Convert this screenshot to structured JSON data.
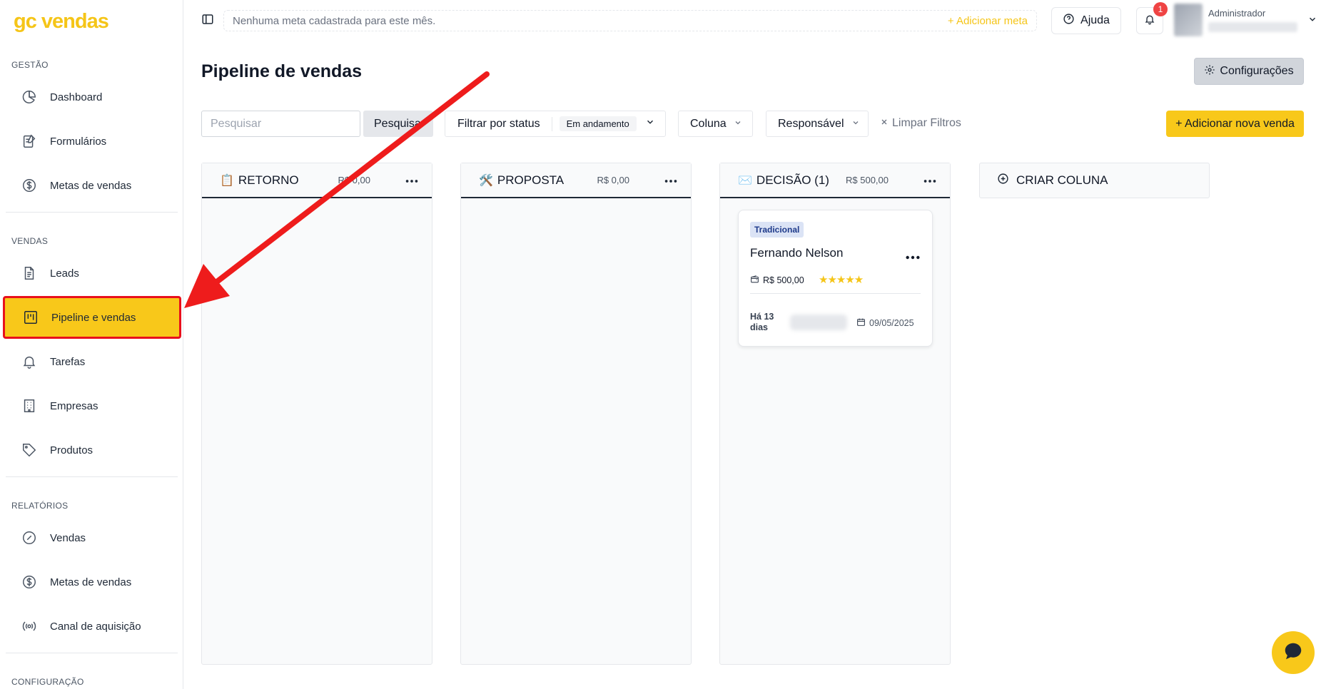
{
  "app": {
    "logo": "gc vendas"
  },
  "sidebar": {
    "sections": {
      "gestao": "GESTÃO",
      "vendas": "VENDAS",
      "relatorios": "RELATÓRIOS",
      "configuracao": "CONFIGURAÇÃO"
    },
    "items": {
      "dashboard": "Dashboard",
      "formularios": "Formulários",
      "metas1": "Metas de vendas",
      "leads": "Leads",
      "pipeline": "Pipeline e vendas",
      "tarefas": "Tarefas",
      "empresas": "Empresas",
      "produtos": "Produtos",
      "vendas_rel": "Vendas",
      "metas2": "Metas de vendas",
      "canal": "Canal de aquisição"
    },
    "active_item": "Pipeline e vendas"
  },
  "topbar": {
    "goal_message": "Nenhuma meta cadastrada para este mês.",
    "goal_add": "+ Adicionar meta",
    "help_label": "Ajuda",
    "notification_count": "1",
    "user_role": "Administrador"
  },
  "page": {
    "title": "Pipeline de vendas",
    "config_label": "Configurações"
  },
  "filters": {
    "search_placeholder": "Pesquisar",
    "search_button": "Pesquisar",
    "status_label": "Filtrar por status",
    "status_value": "Em andamento",
    "column_label": "Coluna",
    "responsible_label": "Responsável",
    "clear_label": "Limpar Filtros",
    "add_sale_label": "+ Adicionar nova venda"
  },
  "columns": [
    {
      "icon": "📋",
      "title": "RETORNO",
      "total": "R$ 0,00"
    },
    {
      "icon": "🛠️",
      "title": "PROPOSTA",
      "total": "R$ 0,00"
    },
    {
      "icon": "✉️",
      "title": "DECISÃO (1)",
      "total": "R$ 500,00"
    }
  ],
  "create_column_label": "CRIAR COLUNA",
  "card": {
    "tag": "Tradicional",
    "name": "Fernando Nelson",
    "value": "R$ 500,00",
    "rating": "★★★★★",
    "age": "Há 13 dias",
    "date": "09/05/2025"
  },
  "colors": {
    "accent": "#f8c81a",
    "brand_logo": "#f5c518",
    "highlight_border": "#e8101c",
    "badge": "#ef4444"
  }
}
